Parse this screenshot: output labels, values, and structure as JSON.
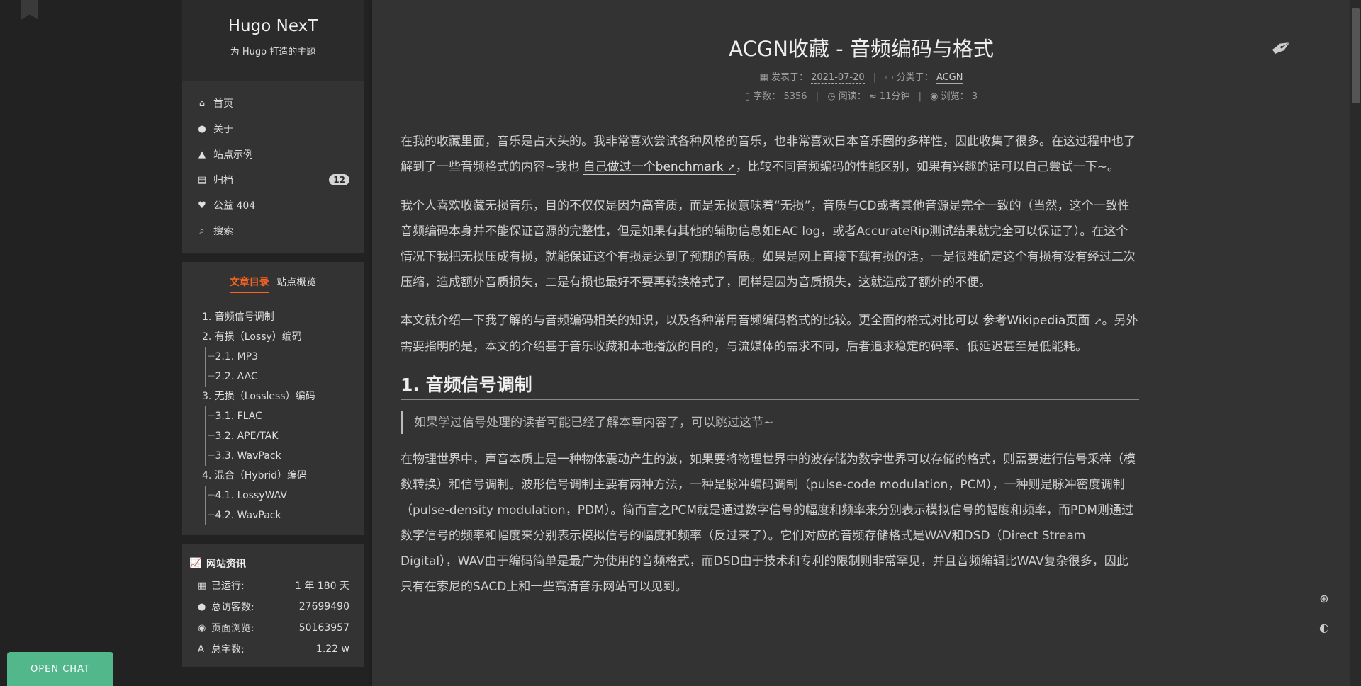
{
  "site": {
    "title": "Hugo NexT",
    "subtitle": "为 Hugo 打造的主题"
  },
  "menu": [
    {
      "label": "首页",
      "icon": "home-icon"
    },
    {
      "label": "关于",
      "icon": "user-icon"
    },
    {
      "label": "站点示例",
      "icon": "thumbs-up-icon"
    },
    {
      "label": "归档",
      "icon": "archive-icon",
      "badge": "12"
    },
    {
      "label": "公益 404",
      "icon": "heartbeat-icon"
    },
    {
      "label": "搜索",
      "icon": "search-icon"
    }
  ],
  "toc": {
    "tab_active": "文章目录",
    "tab_inactive": "站点概览",
    "items": [
      {
        "label": "1. 音频信号调制",
        "level": 1
      },
      {
        "label": "2. 有损（Lossy）编码",
        "level": 1
      },
      {
        "label": "2.1. MP3",
        "level": 2
      },
      {
        "label": "2.2. AAC",
        "level": 2
      },
      {
        "label": "3. 无损（Lossless）编码",
        "level": 1
      },
      {
        "label": "3.1. FLAC",
        "level": 2
      },
      {
        "label": "3.2. APE/TAK",
        "level": 2
      },
      {
        "label": "3.3. WavPack",
        "level": 2
      },
      {
        "label": "4. 混合（Hybrid）编码",
        "level": 1
      },
      {
        "label": "4.1. LossyWAV",
        "level": 2
      },
      {
        "label": "4.2. WavPack",
        "level": 2
      }
    ]
  },
  "site_info": {
    "heading": "网站资讯",
    "rows": [
      {
        "label": "已运行:",
        "value": "1 年 180 天"
      },
      {
        "label": "总访客数:",
        "value": "27699490"
      },
      {
        "label": "页面浏览:",
        "value": "50163957"
      },
      {
        "label": "总字数:",
        "value": "1.22 w"
      }
    ]
  },
  "post": {
    "title": "ACGN收藏 - 音频编码与格式",
    "published_label": "发表于：",
    "published_date": "2021-07-20",
    "category_label": "分类于：",
    "category": "ACGN",
    "words_label": "字数：",
    "words": "5356",
    "read_label": "阅读：",
    "read_time": "≈ 11分钟",
    "views_label": "浏览：",
    "views": "3"
  },
  "body": {
    "p1_a": "在我的收藏里面，音乐是占大头的。我非常喜欢尝试各种风格的音乐，也非常喜欢日本音乐圈的多样性，因此收集了很多。在这过程中也了解到了一些音频格式的内容~我也 ",
    "p1_link": "自己做过一个benchmark",
    "p1_b": "，比较不同音频编码的性能区别，如果有兴趣的话可以自己尝试一下~。",
    "p2": "我个人喜欢收藏无损音乐，目的不仅仅是因为高音质，而是无损意味着“无损”，音质与CD或者其他音源是完全一致的（当然，这个一致性音频编码本身并不能保证音源的完整性，但是如果有其他的辅助信息如EAC log，或者AccurateRip测试结果就完全可以保证了）。在这个情况下我把无损压成有损，就能保证这个有损是达到了预期的音质。如果是网上直接下载有损的话，一是很难确定这个有损有没有经过二次压缩，造成额外音质损失，二是有损也最好不要再转换格式了，同样是因为音质损失，这就造成了额外的不便。",
    "p3_a": "本文就介绍一下我了解的与音频编码相关的知识，以及各种常用音频编码格式的比较。更全面的格式对比可以 ",
    "p3_link": "参考Wikipedia页面",
    "p3_b": "。另外需要指明的是，本文的介绍基于音乐收藏和本地播放的目的，与流媒体的需求不同，后者追求稳定的码率、低延迟甚至是低能耗。",
    "h2": "1. 音频信号调制",
    "quote": "如果学过信号处理的读者可能已经了解本章内容了，可以跳过这节~",
    "p4": "在物理世界中，声音本质上是一种物体震动产生的波，如果要将物理世界中的波存储为数字世界可以存储的格式，则需要进行信号采样（模数转换）和信号调制。波形信号调制主要有两种方法，一种是脉冲编码调制（pulse-code modulation，PCM），一种则是脉冲密度调制（pulse-density modulation，PDM）。简而言之PCM就是通过数字信号的幅度和频率来分别表示模拟信号的幅度和频率，而PDM则通过数字信号的频率和幅度来分别表示模拟信号的幅度和频率（反过来了）。它们对应的音频存储格式是WAV和DSD（Direct Stream Digital），WAV由于编码简单是最广为使用的音频格式，而DSD由于技术和专利的限制则非常罕见，并且音频编辑比WAV复杂很多，因此只有在索尼的SACD上和一些高清音乐网站可以见到。"
  },
  "chat": {
    "label": "OPEN CHAT"
  }
}
